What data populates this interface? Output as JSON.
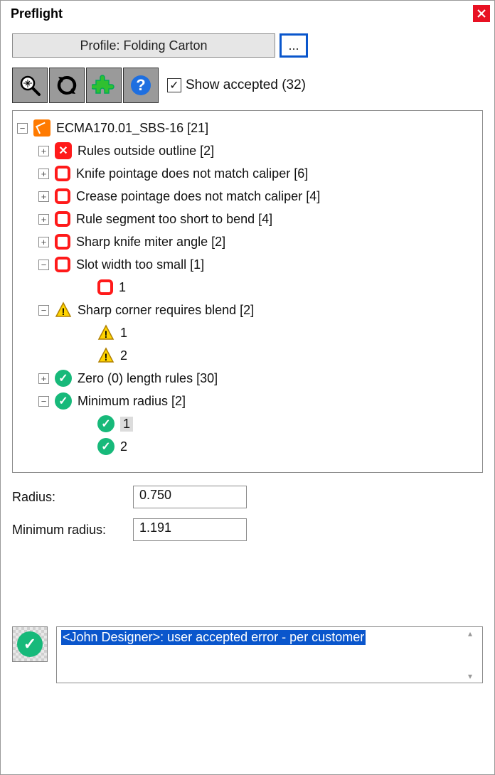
{
  "window": {
    "title": "Preflight"
  },
  "profile": {
    "label": "Profile: Folding Carton",
    "more": "..."
  },
  "toolbar": {
    "show_accepted_label": "Show accepted (32)",
    "show_accepted_checked": "✓"
  },
  "tree": {
    "root": {
      "label": "ECMA170.01_SBS-16 [21]"
    },
    "rules_outside": {
      "label": "Rules outside outline [2]"
    },
    "knife": {
      "label": "Knife pointage does not match caliper [6]"
    },
    "crease": {
      "label": "Crease pointage does not match caliper [4]"
    },
    "segment": {
      "label": "Rule segment too short to bend [4]"
    },
    "miter": {
      "label": "Sharp knife miter angle [2]"
    },
    "slot": {
      "label": "Slot width too small [1]"
    },
    "slot_c1": {
      "label": "1"
    },
    "sharpcorner": {
      "label": "Sharp corner requires blend [2]"
    },
    "sc_c1": {
      "label": "1"
    },
    "sc_c2": {
      "label": "2"
    },
    "zero": {
      "label": "Zero (0) length rules [30]"
    },
    "minrad": {
      "label": "Minimum radius [2]"
    },
    "mr_c1": {
      "label": "1"
    },
    "mr_c2": {
      "label": "2"
    }
  },
  "details": {
    "radius_label": "Radius:",
    "radius_value": "0.750",
    "minradius_label": "Minimum radius:",
    "minradius_value": "1.191"
  },
  "comment": {
    "text": "<John Designer>: user accepted error - per customer"
  }
}
